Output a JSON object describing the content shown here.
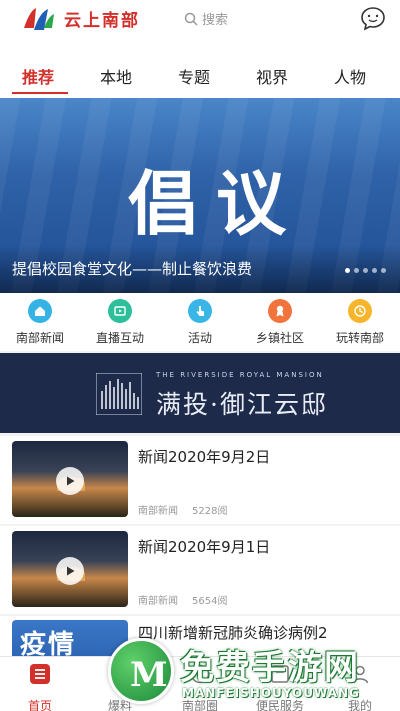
{
  "header": {
    "app_name": "云上南部",
    "search_placeholder": "搜索"
  },
  "tabs": [
    {
      "label": "推荐",
      "active": true
    },
    {
      "label": "本地"
    },
    {
      "label": "专题"
    },
    {
      "label": "视界"
    },
    {
      "label": "人物"
    }
  ],
  "banner": {
    "big_text": "倡议",
    "caption": "提倡校园食堂文化——制止餐饮浪费",
    "slide_count": 5,
    "active_slide": 1
  },
  "quicknav": [
    {
      "label": "南部新闻",
      "icon": "home-icon",
      "color": "#34b3e4"
    },
    {
      "label": "直播互动",
      "icon": "tv-icon",
      "color": "#2cbf9a"
    },
    {
      "label": "活动",
      "icon": "tap-hand-icon",
      "color": "#39b6e6"
    },
    {
      "label": "乡镇社区",
      "icon": "award-icon",
      "color": "#f2733c"
    },
    {
      "label": "玩转南部",
      "icon": "clock-icon",
      "color": "#f7b52c"
    }
  ],
  "ad": {
    "english": "THE RIVERSIDE ROYAL MANSION",
    "chinese": "满投·御江云邸"
  },
  "news": [
    {
      "title": "新闻2020年9月2日",
      "source": "南部新闻",
      "views": "5228阅"
    },
    {
      "title": "新闻2020年9月1日",
      "source": "南部新闻",
      "views": "5654阅"
    },
    {
      "title": "四川新增新冠肺炎确诊病例2",
      "thumb_text": "疫情"
    }
  ],
  "bottom_nav": [
    {
      "label": "首页",
      "icon": "home-menu-icon",
      "active": true
    },
    {
      "label": "爆料",
      "icon": "camera-icon"
    },
    {
      "label": "南部圈",
      "icon": "circle-icon"
    },
    {
      "label": "便民服务",
      "icon": "service-icon"
    },
    {
      "label": "我的",
      "icon": "user-icon"
    }
  ],
  "watermark": {
    "badge_letter": "M",
    "text": "免费手游网",
    "subtext": "MANFEISHOUYOUWANG"
  },
  "colors": {
    "accent": "#d4302b",
    "banner_blue": "#2f62a8",
    "ad_bg": "#1d2a4a"
  }
}
